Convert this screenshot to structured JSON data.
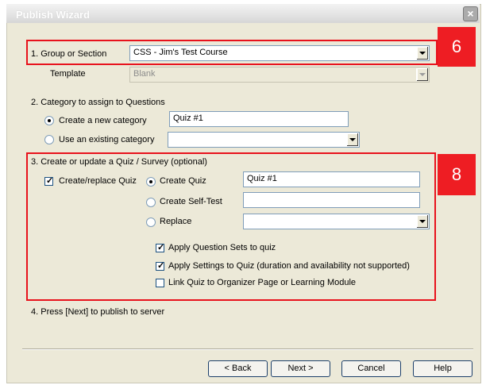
{
  "window": {
    "title": "Publish Wizard"
  },
  "step1": {
    "group_label": "1. Group or Section",
    "group_value": "CSS - Jim's Test Course",
    "template_label": "Template",
    "template_value": "Blank"
  },
  "step2": {
    "heading": "2. Category to assign to Questions",
    "new_category_label": "Create a new category",
    "new_category_value": "Quiz #1",
    "existing_category_label": "Use an existing category",
    "existing_category_value": ""
  },
  "step3": {
    "heading": "3. Create or update a Quiz / Survey (optional)",
    "create_replace_label": "Create/replace Quiz",
    "create_quiz_label": "Create Quiz",
    "create_quiz_value": "Quiz #1",
    "self_test_label": "Create Self-Test",
    "self_test_value": "",
    "replace_label": "Replace",
    "replace_value": "",
    "apply_sets_label": "Apply Question Sets to quiz",
    "apply_settings_label": "Apply Settings to Quiz  (duration and availability not supported)",
    "link_label": "Link Quiz to Organizer Page or Learning Module"
  },
  "step4": {
    "text": "4. Press [Next] to publish to server"
  },
  "buttons": {
    "back": "< Back",
    "next": "Next >",
    "cancel": "Cancel",
    "help": "Help"
  },
  "annotations": {
    "badge_group": "6",
    "badge_quiz": "8",
    "highlight_color": "#ee1d23"
  },
  "state": {
    "create_new_category": true,
    "create_replace_checked": true,
    "quiz_mode": "create_quiz",
    "apply_sets_checked": true,
    "apply_settings_checked": true,
    "link_checked": false
  }
}
